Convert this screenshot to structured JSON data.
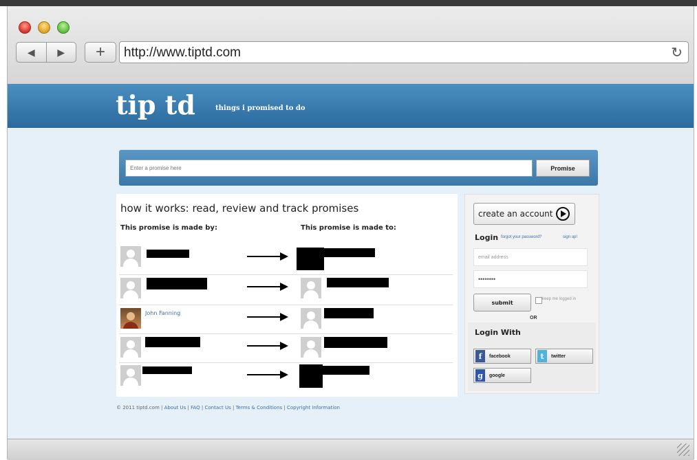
{
  "browser": {
    "url": "http://www.tiptd.com",
    "back_icon": "back-arrow-icon",
    "forward_icon": "forward-arrow-icon",
    "new_tab_label": "+",
    "reload_glyph": "↻"
  },
  "header": {
    "logo": "tip td",
    "tagline": "things i promised to do"
  },
  "promise_form": {
    "placeholder": "Enter a promise here",
    "button_label": "Promise"
  },
  "how_it_works": {
    "title": "how it works: read, review and track promises",
    "made_by_header": "This promise is made by:",
    "made_to_header": "This promise is made to:",
    "named_user": "John Fanning"
  },
  "account": {
    "create_label": "create an account",
    "login_title": "Login",
    "forgot_label": "forgot your password?",
    "signup_label": "sign up!",
    "email_placeholder": "email address",
    "password_value": "••••••••",
    "submit_label": "submit",
    "keep_logged_label": "keep me logged in",
    "or_label": "OR"
  },
  "social_login": {
    "title": "Login With",
    "facebook": "facebook",
    "twitter": "twitter",
    "google": "google"
  },
  "footer": {
    "copyright": "© 2011 tiptd.com",
    "sep": "|",
    "about": "About Us",
    "faq": "FAQ",
    "contact": "Contact Us",
    "terms": "Terms & Conditions",
    "copyright_info": "Copyright Information"
  },
  "colors": {
    "banner": "#2b6a9e",
    "link": "#3b6ea5",
    "facebook": "#3b5998",
    "twitter": "#4fb3d9",
    "google": "#2d56b0"
  }
}
